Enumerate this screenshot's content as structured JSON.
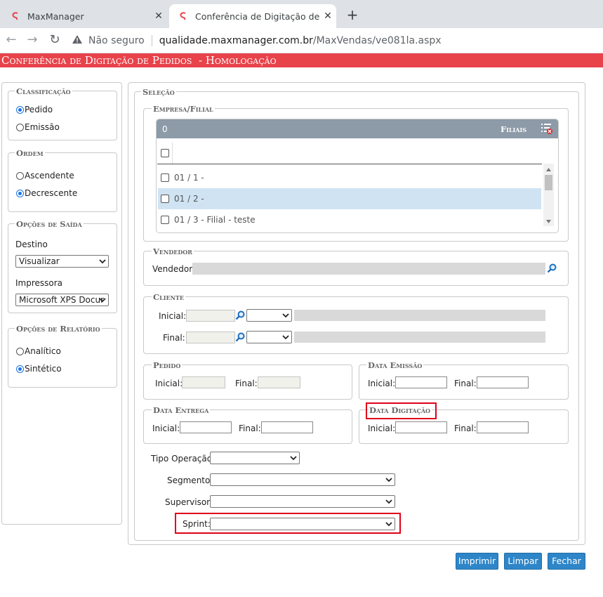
{
  "browser": {
    "tabs": [
      {
        "title": "MaxManager",
        "active": false
      },
      {
        "title": "Conferência de Digitação de Pedi",
        "active": true
      }
    ],
    "security_label": "Não seguro",
    "url_host": "qualidade.maxmanager.com.br",
    "url_path": "/MaxVendas/ve081la.aspx"
  },
  "page": {
    "title": "Conferência de Digitação de Pedidos  - Homologação",
    "accent_color": "#e8424a"
  },
  "classificacao": {
    "legend": "Classificação",
    "options": [
      {
        "label": "Pedido",
        "checked": true
      },
      {
        "label": "Emissão",
        "checked": false
      }
    ]
  },
  "ordem": {
    "legend": "Ordem",
    "options": [
      {
        "label": "Ascendente",
        "checked": false
      },
      {
        "label": "Decrescente",
        "checked": true
      }
    ]
  },
  "opcoes_saida": {
    "legend": "Opções de Saída",
    "destino_label": "Destino",
    "destino_value": "Visualizar",
    "impressora_label": "Impressora",
    "impressora_value": "Microsoft XPS Docur"
  },
  "opcoes_relatorio": {
    "legend": "Opções de Relatório",
    "options": [
      {
        "label": "Analítico",
        "checked": false
      },
      {
        "label": "Sintético",
        "checked": true
      }
    ]
  },
  "selecao": {
    "legend": "Seleção",
    "empresa_filial": {
      "legend": "Empresa/Filial",
      "count": "0",
      "header_label": "Filiais",
      "rows": [
        {
          "label": "01 / 1 -",
          "selected": false
        },
        {
          "label": "01 / 2 -",
          "selected": true
        },
        {
          "label": "01 / 3 - Filial - teste",
          "selected": false
        }
      ]
    },
    "vendedor": {
      "legend": "Vendedor",
      "label": "Vendedor:"
    },
    "cliente": {
      "legend": "Cliente",
      "inicial_label": "Inicial:",
      "final_label": "Final:"
    },
    "pedido": {
      "legend": "Pedido",
      "inicial_label": "Inicial:",
      "final_label": "Final:"
    },
    "data_emissao": {
      "legend": "Data Emissão",
      "inicial_label": "Inicial:",
      "final_label": "Final:"
    },
    "data_entrega": {
      "legend": "Data Entrega",
      "inicial_label": "Inicial:",
      "final_label": "Final:"
    },
    "data_digitacao": {
      "legend": "Data Digitação",
      "inicial_label": "Inicial:",
      "final_label": "Final:"
    },
    "tipo_operacao_label": "Tipo Operação:",
    "segmento_label": "Segmento:",
    "supervisor_label": "Supervisor:",
    "sprint_label": "Sprint:"
  },
  "buttons": {
    "imprimir": "Imprimir",
    "limpar": "Limpar",
    "fechar": "Fechar"
  }
}
